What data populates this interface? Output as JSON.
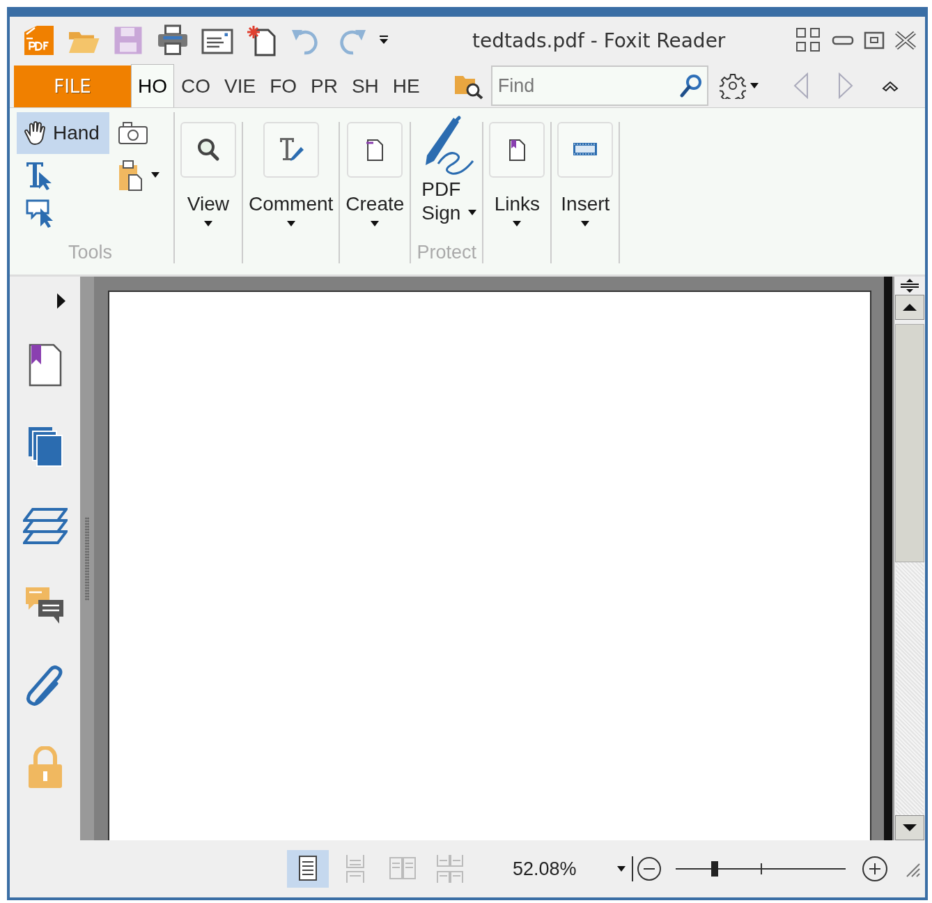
{
  "window": {
    "title": "tedtads.pdf - Foxit Reader"
  },
  "tabs": [
    {
      "label": "FILE",
      "kind": "file",
      "selected": false
    },
    {
      "label": "HO",
      "kind": "tab",
      "selected": true
    },
    {
      "label": "CO",
      "kind": "tab",
      "selected": false
    },
    {
      "label": "VIE",
      "kind": "tab",
      "selected": false
    },
    {
      "label": "FO",
      "kind": "tab",
      "selected": false
    },
    {
      "label": "PR",
      "kind": "tab",
      "selected": false
    },
    {
      "label": "SH",
      "kind": "tab",
      "selected": false
    },
    {
      "label": "HE",
      "kind": "tab",
      "selected": false
    }
  ],
  "search": {
    "placeholder": "Find"
  },
  "ribbon": {
    "tools": {
      "label": "Tools",
      "hand": {
        "label": "Hand",
        "selected": true
      }
    },
    "buttons": [
      {
        "label": "View"
      },
      {
        "label": "Comment"
      },
      {
        "label": "Create"
      },
      {
        "label": "PDF Sign",
        "group": "Protect"
      },
      {
        "label": "Links"
      },
      {
        "label": "Insert"
      }
    ]
  },
  "status_bar": {
    "view_modes": [
      {
        "selected": true
      },
      {
        "selected": false
      },
      {
        "selected": false
      },
      {
        "selected": false
      }
    ],
    "zoom": {
      "value": "52.08%",
      "level": 0.23
    }
  }
}
